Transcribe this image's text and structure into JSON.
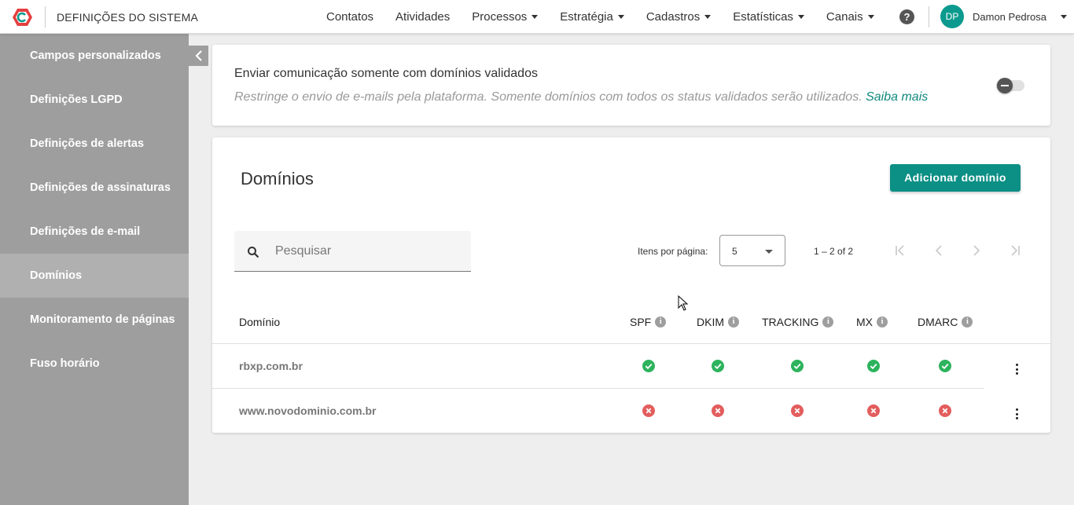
{
  "header": {
    "app_title": "DEFINIÇÕES DO SISTEMA",
    "nav": [
      {
        "label": "Contatos",
        "dropdown": false
      },
      {
        "label": "Atividades",
        "dropdown": false
      },
      {
        "label": "Processos",
        "dropdown": true
      },
      {
        "label": "Estratégia",
        "dropdown": true
      },
      {
        "label": "Cadastros",
        "dropdown": true
      },
      {
        "label": "Estatísticas",
        "dropdown": true
      },
      {
        "label": "Canais",
        "dropdown": true
      }
    ],
    "help_icon": "question-icon",
    "help_glyph": "?",
    "user": {
      "initials": "DP",
      "name": "Damon Pedrosa",
      "avatar_color": "#0c9a8e"
    }
  },
  "sidebar": {
    "items": [
      {
        "label": "Campos personalizados",
        "active": false
      },
      {
        "label": "Definições LGPD",
        "active": false
      },
      {
        "label": "Definições de alertas",
        "active": false
      },
      {
        "label": "Definições de assinaturas",
        "active": false
      },
      {
        "label": "Definições de e-mail",
        "active": false
      },
      {
        "label": "Domínios",
        "active": true
      },
      {
        "label": "Monitoramento de páginas",
        "active": false
      },
      {
        "label": "Fuso horário",
        "active": false
      }
    ]
  },
  "validated_setting": {
    "title": "Enviar comunicação somente com domínios validados",
    "description": "Restringe o envio de e-mails pela plataforma. Somente domínios com todos os status validados serão utilizados.",
    "link_text": "Saiba mais",
    "toggle_on": false
  },
  "domains": {
    "title": "Domínios",
    "add_button": "Adicionar domínio",
    "search_placeholder": "Pesquisar",
    "search_value": "",
    "items_per_page_label": "Itens por página:",
    "items_per_page_value": "5",
    "range_label": "1 – 2 of 2",
    "columns": {
      "domain": "Domínio",
      "spf": "SPF",
      "dkim": "DKIM",
      "tracking": "TRACKING",
      "mx": "MX",
      "dmarc": "DMARC"
    },
    "info_glyph": "i",
    "rows": [
      {
        "domain": "rbxp.com.br",
        "spf": "ok",
        "dkim": "ok",
        "tracking": "ok",
        "mx": "ok",
        "dmarc": "ok"
      },
      {
        "domain": "www.novodominio.com.br",
        "spf": "error",
        "dkim": "error",
        "tracking": "error",
        "mx": "error",
        "dmarc": "error"
      }
    ]
  },
  "colors": {
    "accent": "#0c8f85",
    "success": "#2db35d",
    "error": "#e35d5d",
    "sidebar_bg": "#9e9e9e",
    "sidebar_active": "#b0b0b0"
  }
}
